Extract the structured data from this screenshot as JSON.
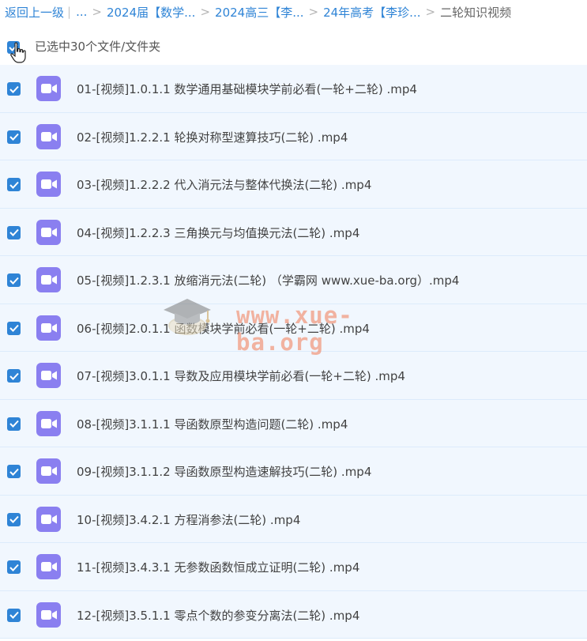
{
  "breadcrumb": {
    "back_label": "返回上一级",
    "pipe": "|",
    "ellipsis": "...",
    "separator": ">",
    "items": [
      "2024届【数学...",
      "2024高三【李...",
      "24年高考【李珍..."
    ],
    "current": "二轮知识视频"
  },
  "selection": {
    "text": "已选中30个文件/文件夹"
  },
  "files": [
    {
      "name": "01-[视频]1.0.1.1 数学通用基础模块学前必看(一轮+二轮) .mp4",
      "checked": true,
      "icon": "video-file-icon"
    },
    {
      "name": "02-[视频]1.2.2.1 轮换对称型速算技巧(二轮) .mp4",
      "checked": true,
      "icon": "video-file-icon"
    },
    {
      "name": "03-[视频]1.2.2.2 代入消元法与整体代换法(二轮) .mp4",
      "checked": true,
      "icon": "video-file-icon"
    },
    {
      "name": "04-[视频]1.2.2.3 三角换元与均值换元法(二轮) .mp4",
      "checked": true,
      "icon": "video-file-icon"
    },
    {
      "name": "05-[视频]1.2.3.1 放缩消元法(二轮) （学霸网 www.xue-ba.org）.mp4",
      "checked": true,
      "icon": "video-file-icon"
    },
    {
      "name": "06-[视频]2.0.1.1 函数模块学前必看(一轮+二轮) .mp4",
      "checked": true,
      "icon": "video-file-icon"
    },
    {
      "name": "07-[视频]3.0.1.1 导数及应用模块学前必看(一轮+二轮) .mp4",
      "checked": true,
      "icon": "video-file-icon"
    },
    {
      "name": "08-[视频]3.1.1.1 导函数原型构造问题(二轮) .mp4",
      "checked": true,
      "icon": "video-file-icon"
    },
    {
      "name": "09-[视频]3.1.1.2 导函数原型构造速解技巧(二轮) .mp4",
      "checked": true,
      "icon": "video-file-icon"
    },
    {
      "name": "10-[视频]3.4.2.1 方程消参法(二轮) .mp4",
      "checked": true,
      "icon": "video-file-icon"
    },
    {
      "name": "11-[视频]3.4.3.1 无参数函数恒成立证明(二轮) .mp4",
      "checked": true,
      "icon": "video-file-icon"
    },
    {
      "name": "12-[视频]3.5.1.1 零点个数的参变分离法(二轮) .mp4",
      "checked": true,
      "icon": "video-file-icon"
    }
  ],
  "watermark": {
    "text": "www.xue-ba.org"
  },
  "colors": {
    "link": "#2f84d6",
    "row_bg": "#f1f7fe",
    "row_border": "#dcebfb",
    "checkbox": "#2f84d6",
    "video_icon": "#8a7ff0",
    "watermark": "#f27a55"
  }
}
